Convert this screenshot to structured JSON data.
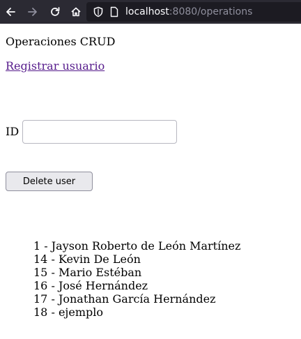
{
  "browser": {
    "url_host": "localhost",
    "url_rest": ":8080/operations",
    "icons": [
      "back-arrow-icon",
      "forward-arrow-icon",
      "reload-icon",
      "home-icon",
      "shield-icon",
      "page-icon"
    ]
  },
  "page": {
    "heading": "Operaciones CRUD",
    "register_link": "Registrar usuario",
    "id_label": "ID",
    "id_value": "",
    "delete_button": "Delete user",
    "users": [
      "1 - Jayson Roberto de León Martínez",
      "14 - Kevin De León",
      "15 - Mario Estéban",
      "16 - José Hernández",
      "17 - Jonathan García Hernández",
      "18 - ejemplo"
    ]
  }
}
